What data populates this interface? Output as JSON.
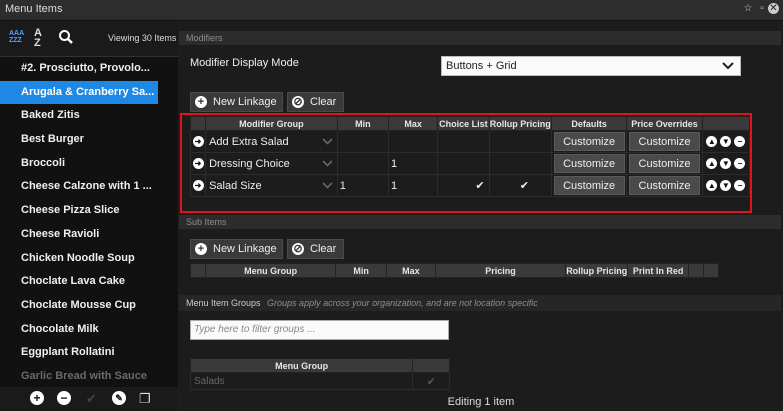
{
  "window": {
    "title": "Menu Items"
  },
  "sidebar": {
    "viewing": "Viewing 30 Items",
    "items": [
      {
        "label": "#2. Prosciutto, Provolo..."
      },
      {
        "label": "Arugala & Cranberry Sa..."
      },
      {
        "label": "Baked Zitis"
      },
      {
        "label": "Best Burger"
      },
      {
        "label": "Broccoli"
      },
      {
        "label": "Cheese Calzone with 1 ..."
      },
      {
        "label": "Cheese Pizza Slice"
      },
      {
        "label": "Cheese Ravioli"
      },
      {
        "label": "Chicken Noodle Soup"
      },
      {
        "label": "Choclate Lava Cake"
      },
      {
        "label": "Choclate Mousse Cup"
      },
      {
        "label": "Chocolate Milk"
      },
      {
        "label": "Eggplant Rollatini"
      },
      {
        "label": "Garlic Bread with Sauce"
      }
    ],
    "selected_index": 1
  },
  "modifiers": {
    "section_title": "Modifiers",
    "display_mode_label": "Modifier Display Mode",
    "display_mode_value": "Buttons + Grid",
    "new_linkage": "New Linkage",
    "clear": "Clear",
    "columns": [
      "Modifier Group",
      "Min",
      "Max",
      "Choice List",
      "Rollup Pricing",
      "Defaults",
      "Price Overrides"
    ],
    "rows": [
      {
        "name": "Add Extra Salad",
        "min": "",
        "max": "",
        "choice_list": false,
        "rollup": false,
        "defaults": "Customize",
        "overrides": "Customize"
      },
      {
        "name": "Dressing Choice",
        "min": "",
        "max": "1",
        "choice_list": false,
        "rollup": false,
        "defaults": "Customize",
        "overrides": "Customize"
      },
      {
        "name": "Salad Size",
        "min": "1",
        "max": "1",
        "choice_list": true,
        "rollup": true,
        "defaults": "Customize",
        "overrides": "Customize"
      }
    ]
  },
  "sub_items": {
    "section_title": "Sub Items",
    "new_linkage": "New Linkage",
    "clear": "Clear",
    "columns": [
      "Menu Group",
      "Min",
      "Max",
      "Pricing",
      "Rollup Pricing",
      "Print In Red"
    ]
  },
  "groups": {
    "section_title": "Menu Item Groups",
    "section_note": "Groups apply across your organization, and are not location specific",
    "filter_placeholder": "Type here to filter groups ...",
    "column": "Menu Group",
    "rows": [
      {
        "name": "Salads",
        "checked": true
      }
    ]
  },
  "status": "Editing 1 item",
  "colors": {
    "accent": "#1e88e5",
    "highlight_box": "#e0141e"
  }
}
